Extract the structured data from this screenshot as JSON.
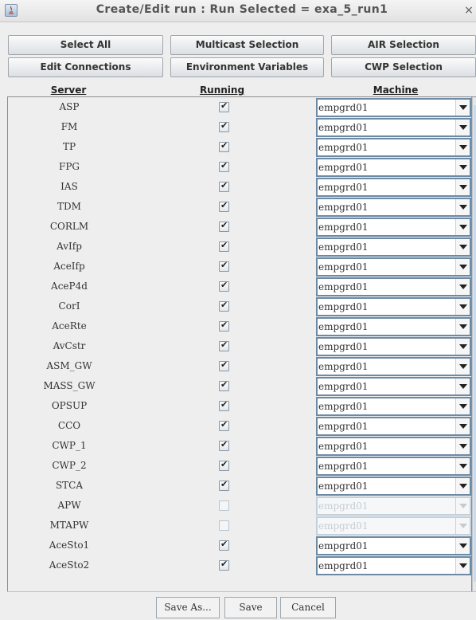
{
  "window": {
    "title": "Create/Edit run : Run Selected = exa_5_run1",
    "close_label": "×"
  },
  "buttons": {
    "select_all": "Select All",
    "multicast_selection": "Multicast Selection",
    "air_selection": "AIR Selection",
    "edit_connections": "Edit Connections",
    "environment_variables": "Environment Variables",
    "cwp_selection": "CWP Selection"
  },
  "table": {
    "headers": {
      "server": "Server",
      "running": "Running",
      "machine": "Machine"
    },
    "rows": [
      {
        "server": "ASP",
        "running": true,
        "machine": "empgrd01",
        "enabled": true
      },
      {
        "server": "FM",
        "running": true,
        "machine": "empgrd01",
        "enabled": true
      },
      {
        "server": "TP",
        "running": true,
        "machine": "empgrd01",
        "enabled": true
      },
      {
        "server": "FPG",
        "running": true,
        "machine": "empgrd01",
        "enabled": true
      },
      {
        "server": "IAS",
        "running": true,
        "machine": "empgrd01",
        "enabled": true
      },
      {
        "server": "TDM",
        "running": true,
        "machine": "empgrd01",
        "enabled": true
      },
      {
        "server": "CORLM",
        "running": true,
        "machine": "empgrd01",
        "enabled": true
      },
      {
        "server": "AvIfp",
        "running": true,
        "machine": "empgrd01",
        "enabled": true
      },
      {
        "server": "AceIfp",
        "running": true,
        "machine": "empgrd01",
        "enabled": true
      },
      {
        "server": "AceP4d",
        "running": true,
        "machine": "empgrd01",
        "enabled": true
      },
      {
        "server": "CorI",
        "running": true,
        "machine": "empgrd01",
        "enabled": true
      },
      {
        "server": "AceRte",
        "running": true,
        "machine": "empgrd01",
        "enabled": true
      },
      {
        "server": "AvCstr",
        "running": true,
        "machine": "empgrd01",
        "enabled": true
      },
      {
        "server": "ASM_GW",
        "running": true,
        "machine": "empgrd01",
        "enabled": true
      },
      {
        "server": "MASS_GW",
        "running": true,
        "machine": "empgrd01",
        "enabled": true
      },
      {
        "server": "OPSUP",
        "running": true,
        "machine": "empgrd01",
        "enabled": true
      },
      {
        "server": "CCO",
        "running": true,
        "machine": "empgrd01",
        "enabled": true
      },
      {
        "server": "CWP_1",
        "running": true,
        "machine": "empgrd01",
        "enabled": true
      },
      {
        "server": "CWP_2",
        "running": true,
        "machine": "empgrd01",
        "enabled": true
      },
      {
        "server": "STCA",
        "running": true,
        "machine": "empgrd01",
        "enabled": true
      },
      {
        "server": "APW",
        "running": false,
        "machine": "empgrd01",
        "enabled": false
      },
      {
        "server": "MTAPW",
        "running": false,
        "machine": "empgrd01",
        "enabled": false
      },
      {
        "server": "AceSto1",
        "running": true,
        "machine": "empgrd01",
        "enabled": true
      },
      {
        "server": "AceSto2",
        "running": true,
        "machine": "empgrd01",
        "enabled": true
      }
    ]
  },
  "footer": {
    "save_as": "Save As...",
    "save": "Save",
    "cancel": "Cancel"
  }
}
